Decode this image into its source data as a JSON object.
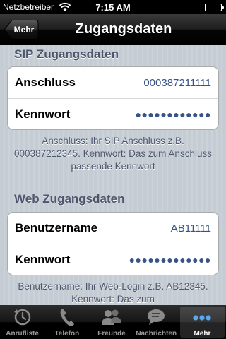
{
  "status_bar": {
    "carrier": "Netzbetreiber",
    "time": "7:15 AM",
    "battery_level": 1.0
  },
  "nav_bar": {
    "back_label": "Mehr",
    "title": "Zugangsdaten"
  },
  "sip_section": {
    "header": "SIP Zugangsdaten",
    "rows": [
      {
        "label": "Anschluss",
        "value": "000387211111"
      },
      {
        "label": "Kennwort",
        "value": "●●●●●●●●●●●●"
      }
    ],
    "footer": "Anschluss: Ihr SIP Anschluss z.B. 000387212345. Kennwort: Das zum Anschluss passende Kennwort"
  },
  "web_section": {
    "header": "Web Zugangsdaten",
    "rows": [
      {
        "label": "Benutzername",
        "value": "AB11111"
      },
      {
        "label": "Kennwort",
        "value": "●●●●●●●●●●●●●"
      }
    ],
    "footer": "Benutzername: Ihr Web-Login z.B. AB12345. Kennwort: Das zum"
  },
  "tab_bar": {
    "tabs": [
      {
        "label": "Anrufliste",
        "icon": "call-log-icon"
      },
      {
        "label": "Telefon",
        "icon": "phone-icon"
      },
      {
        "label": "Freunde",
        "icon": "friends-icon"
      },
      {
        "label": "Nachrichten",
        "icon": "messages-icon"
      },
      {
        "label": "Mehr",
        "icon": "more-icon"
      }
    ],
    "selected": "Mehr"
  },
  "colors": {
    "accent_value": "#385487",
    "section_text": "#4c566c",
    "tab_active": "#5aa8f0"
  }
}
